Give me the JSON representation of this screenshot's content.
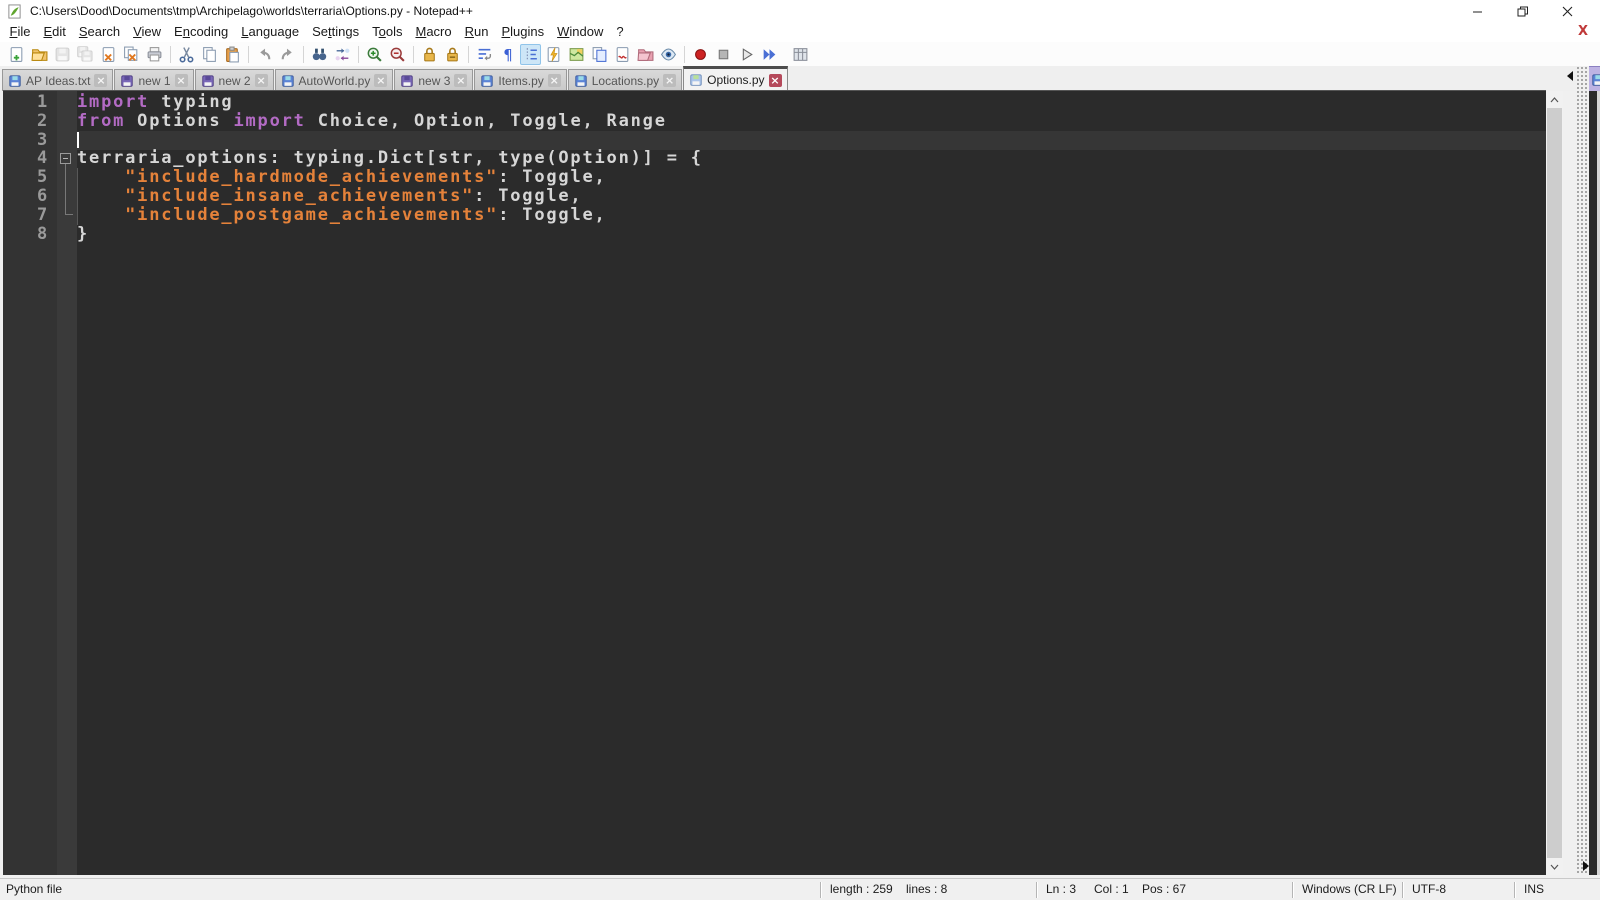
{
  "window": {
    "title": "C:\\Users\\Dood\\Documents\\tmp\\Archipelago\\worlds\\terraria\\Options.py - Notepad++",
    "controls": [
      {
        "name": "minimize-button",
        "glyph": "minimize"
      },
      {
        "name": "restore-button",
        "glyph": "restore"
      },
      {
        "name": "close-button",
        "glyph": "close"
      }
    ],
    "doc_close_label": "X"
  },
  "menu": {
    "items": [
      {
        "label": "File",
        "underline_index": 0
      },
      {
        "label": "Edit",
        "underline_index": 0
      },
      {
        "label": "Search",
        "underline_index": 0
      },
      {
        "label": "View",
        "underline_index": 0
      },
      {
        "label": "Encoding",
        "underline_index": 1
      },
      {
        "label": "Language",
        "underline_index": 0
      },
      {
        "label": "Settings",
        "underline_index": 2
      },
      {
        "label": "Tools",
        "underline_index": 1
      },
      {
        "label": "Macro",
        "underline_index": 0
      },
      {
        "label": "Run",
        "underline_index": 0
      },
      {
        "label": "Plugins",
        "underline_index": 0
      },
      {
        "label": "Window",
        "underline_index": 0
      },
      {
        "label": "?",
        "underline_index": -1
      }
    ]
  },
  "toolbar": {
    "buttons": [
      {
        "name": "new-file"
      },
      {
        "name": "open-file"
      },
      {
        "name": "save",
        "disabled": true
      },
      {
        "name": "save-all",
        "disabled": true
      },
      {
        "name": "close"
      },
      {
        "name": "close-all"
      },
      {
        "name": "print"
      },
      {
        "sep": true
      },
      {
        "name": "cut"
      },
      {
        "name": "copy"
      },
      {
        "name": "paste"
      },
      {
        "sep": true
      },
      {
        "name": "undo"
      },
      {
        "name": "redo"
      },
      {
        "sep": true
      },
      {
        "name": "find"
      },
      {
        "name": "replace"
      },
      {
        "sep": true
      },
      {
        "name": "zoom-in"
      },
      {
        "name": "zoom-out"
      },
      {
        "sep": true
      },
      {
        "name": "sync-vertical-scroll"
      },
      {
        "name": "sync-horizontal-scroll"
      },
      {
        "sep": true
      },
      {
        "name": "word-wrap"
      },
      {
        "name": "show-all-characters"
      },
      {
        "name": "show-indent-guide",
        "active": true
      },
      {
        "name": "user-defined-language"
      },
      {
        "name": "document-map"
      },
      {
        "name": "document-list"
      },
      {
        "name": "function-list"
      },
      {
        "name": "folder-as-workspace"
      },
      {
        "name": "monitoring"
      },
      {
        "sep": true
      },
      {
        "name": "macro-record"
      },
      {
        "name": "macro-stop"
      },
      {
        "name": "macro-play"
      },
      {
        "name": "macro-run-multiple"
      },
      {
        "gap": true
      },
      {
        "name": "macro-save"
      }
    ]
  },
  "tabs": [
    {
      "label": "AP Ideas.txt",
      "state": "saved"
    },
    {
      "label": "new 1",
      "state": "modified"
    },
    {
      "label": "new 2",
      "state": "modified"
    },
    {
      "label": "AutoWorld.py",
      "state": "saved"
    },
    {
      "label": "new 3",
      "state": "modified"
    },
    {
      "label": "Items.py",
      "state": "saved"
    },
    {
      "label": "Locations.py",
      "state": "saved"
    },
    {
      "label": "Options.py",
      "state": "saved",
      "active": true
    }
  ],
  "editor": {
    "caret": {
      "line": 3,
      "col": 1
    },
    "lines": [
      {
        "num": "1",
        "segs": [
          [
            "kw",
            "import"
          ],
          [
            "df",
            " typing"
          ]
        ]
      },
      {
        "num": "2",
        "segs": [
          [
            "kw",
            "from"
          ],
          [
            "df",
            " Options "
          ],
          [
            "kw",
            "import"
          ],
          [
            "df",
            " Choice, Option, Toggle, Range"
          ]
        ]
      },
      {
        "num": "3",
        "segs": []
      },
      {
        "num": "4",
        "segs": [
          [
            "df",
            "terraria_options: typing.Dict[str, type(Option)] = {"
          ]
        ],
        "fold": "open"
      },
      {
        "num": "5",
        "segs": [
          [
            "df",
            "    "
          ],
          [
            "str",
            "\"include_hardmode_achievements\""
          ],
          [
            "df",
            ": Toggle,"
          ]
        ]
      },
      {
        "num": "6",
        "segs": [
          [
            "df",
            "    "
          ],
          [
            "str",
            "\"include_insane_achievements\""
          ],
          [
            "df",
            ": Toggle,"
          ]
        ]
      },
      {
        "num": "7",
        "segs": [
          [
            "df",
            "    "
          ],
          [
            "str",
            "\"include_postgame_achievements\""
          ],
          [
            "df",
            ": Toggle,"
          ]
        ]
      },
      {
        "num": "8",
        "segs": [
          [
            "df",
            "}"
          ]
        ]
      }
    ]
  },
  "status_bar": {
    "doc_type": "Python file",
    "length": "length : 259",
    "lines": "lines : 8",
    "ln": "Ln : 3",
    "col": "Col : 1",
    "pos": "Pos : 67",
    "eol": "Windows (CR LF)",
    "encoding": "UTF-8",
    "insert_mode": "INS"
  },
  "colors": {
    "keyword": "#b36bc4",
    "string": "#e5823a",
    "default_text": "#d6d6d6",
    "line_number": "#9a9a9a",
    "editor_bg": "#2b2b2b",
    "gutter_bg": "#333333",
    "fold_margin_bg": "#3a3a3a",
    "current_line_bg": "#363636",
    "tab_active_close": "#b5495b",
    "statusbar_bg": "#f0f0f0",
    "saved_icon_body": "#5c83d6",
    "modified_icon_body": "#7a68b8",
    "active_icon_body": "#aac4ea"
  }
}
